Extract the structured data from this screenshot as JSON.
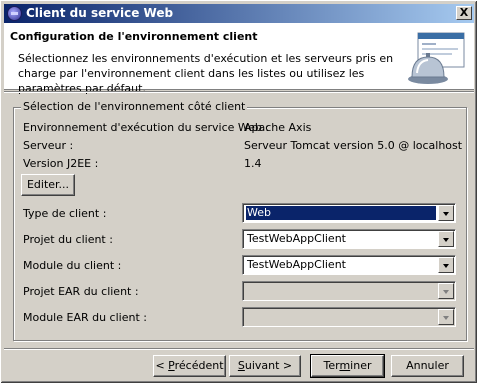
{
  "window": {
    "title": "Client du service Web",
    "close_label": "X"
  },
  "banner": {
    "title": "Configuration de l'environnement client",
    "description": "Sélectionnez les environnements d'exécution et les serveurs pris en charge par l'environnement client dans les listes ou utilisez les paramètres par défaut.",
    "icon": "web-service-bell-icon"
  },
  "group": {
    "legend": "Sélection de l'environnement côté client",
    "runtime_label": "Environnement d'exécution du service Web :",
    "runtime_value": "Apache Axis",
    "server_label": "Serveur :",
    "server_value": "Serveur Tomcat version 5.0 @ localhost",
    "j2ee_label": "Version J2EE :",
    "j2ee_value": "1.4",
    "edit_button": "Editer..."
  },
  "fields": {
    "client_type_label": "Type de client :",
    "client_type_value": "Web",
    "client_project_label": "Projet du client :",
    "client_project_value": "TestWebAppClient",
    "client_module_label": "Module du client :",
    "client_module_value": "TestWebAppClient",
    "ear_project_label": "Projet EAR du client :",
    "ear_project_value": "",
    "ear_module_label": "Module EAR du client :",
    "ear_module_value": ""
  },
  "buttons": {
    "back_prefix": "< ",
    "back_mnemonic": "P",
    "back_rest": "récédent",
    "next_mnemonic": "S",
    "next_rest": "uivant >",
    "finish_pre": "Ter",
    "finish_mnemonic": "m",
    "finish_rest": "iner",
    "cancel": "Annuler"
  }
}
